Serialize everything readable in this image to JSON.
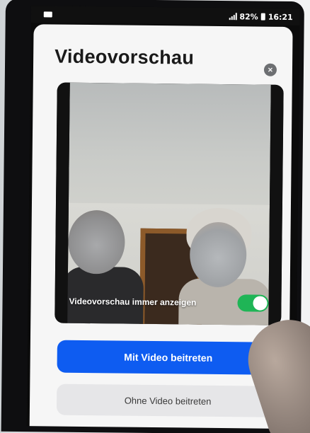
{
  "status_bar": {
    "battery": "82%",
    "time": "16:21"
  },
  "dialog": {
    "title": "Videovorschau",
    "close_icon": "×"
  },
  "preview": {
    "toggle_label": "Videovorschau immer anzeigen",
    "toggle_on": true
  },
  "buttons": {
    "join_with_video": "Mit Video beitreten",
    "join_without_video": "Ohne Video beitreten"
  },
  "colors": {
    "primary": "#0e5cf1",
    "toggle_on": "#1fb556"
  }
}
